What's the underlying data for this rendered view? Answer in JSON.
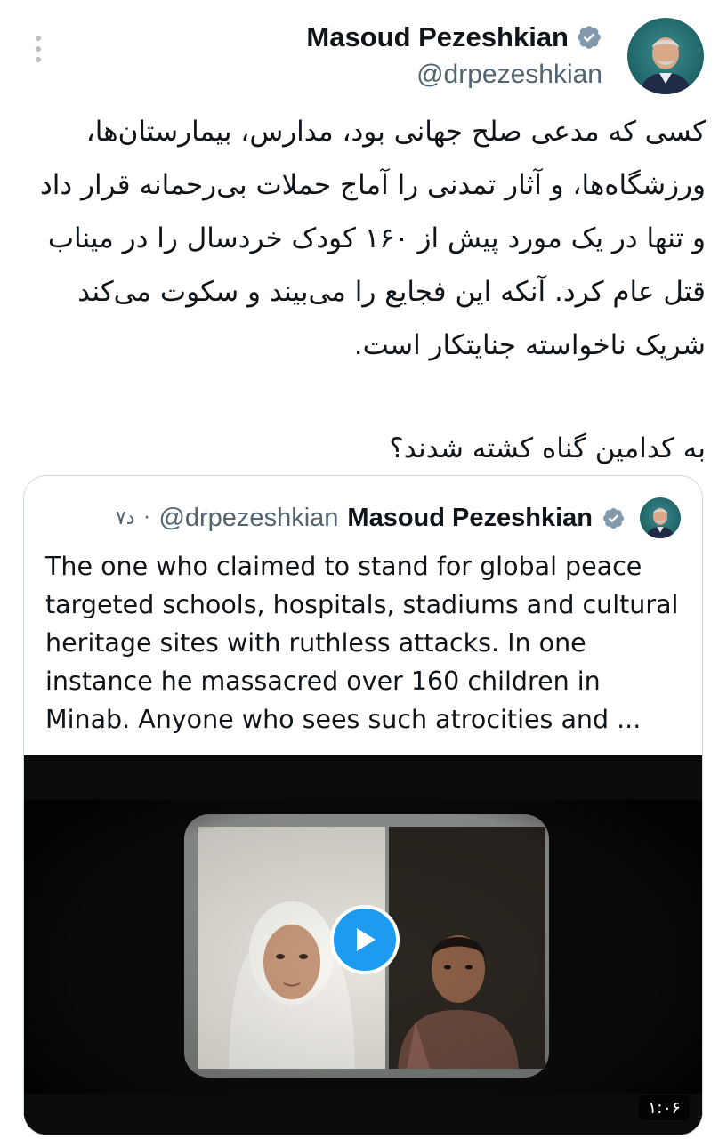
{
  "header": {
    "author_name": "Masoud Pezeshkian",
    "author_handle": "@drpezeshkian",
    "more_icon": "more-vertical-icon",
    "verified_icon": "verified-badge-icon"
  },
  "tweet": {
    "body": "کسی که مدعی صلح جهانی بود، مدارس، بیمارستان‌ها، ورزشگاه‌ها، و آثار تمدنی را آماج حملات بی‌رحمانه قرار داد و تنها در یک مورد پیش از ۱۶۰ کودک خردسال را در میناب قتل عام کرد. آنکه این فجایع را می‌بیند و سکوت می‌کند شریک ناخواسته جنایتکار است.",
    "question": "به کدامین گناه کشته شدند؟"
  },
  "quote": {
    "name": "Masoud Pezeshkian",
    "handle": "@drpezeshkian",
    "separator": "·",
    "time": "۷د",
    "text": "The one who claimed to stand for global peace targeted schools, hospitals, stadiums and cultural heritage sites with ruthless attacks. In one instance he massacred over 160 children in Minab. Anyone who sees such atrocities and ...",
    "video": {
      "duration": "۱:۰۶",
      "play_icon": "play-icon"
    }
  },
  "colors": {
    "text_primary": "#0f1419",
    "text_secondary": "#536471",
    "verified_gray": "#829aab",
    "play_blue": "#1d9bf0",
    "card_border": "#cfd9de"
  }
}
